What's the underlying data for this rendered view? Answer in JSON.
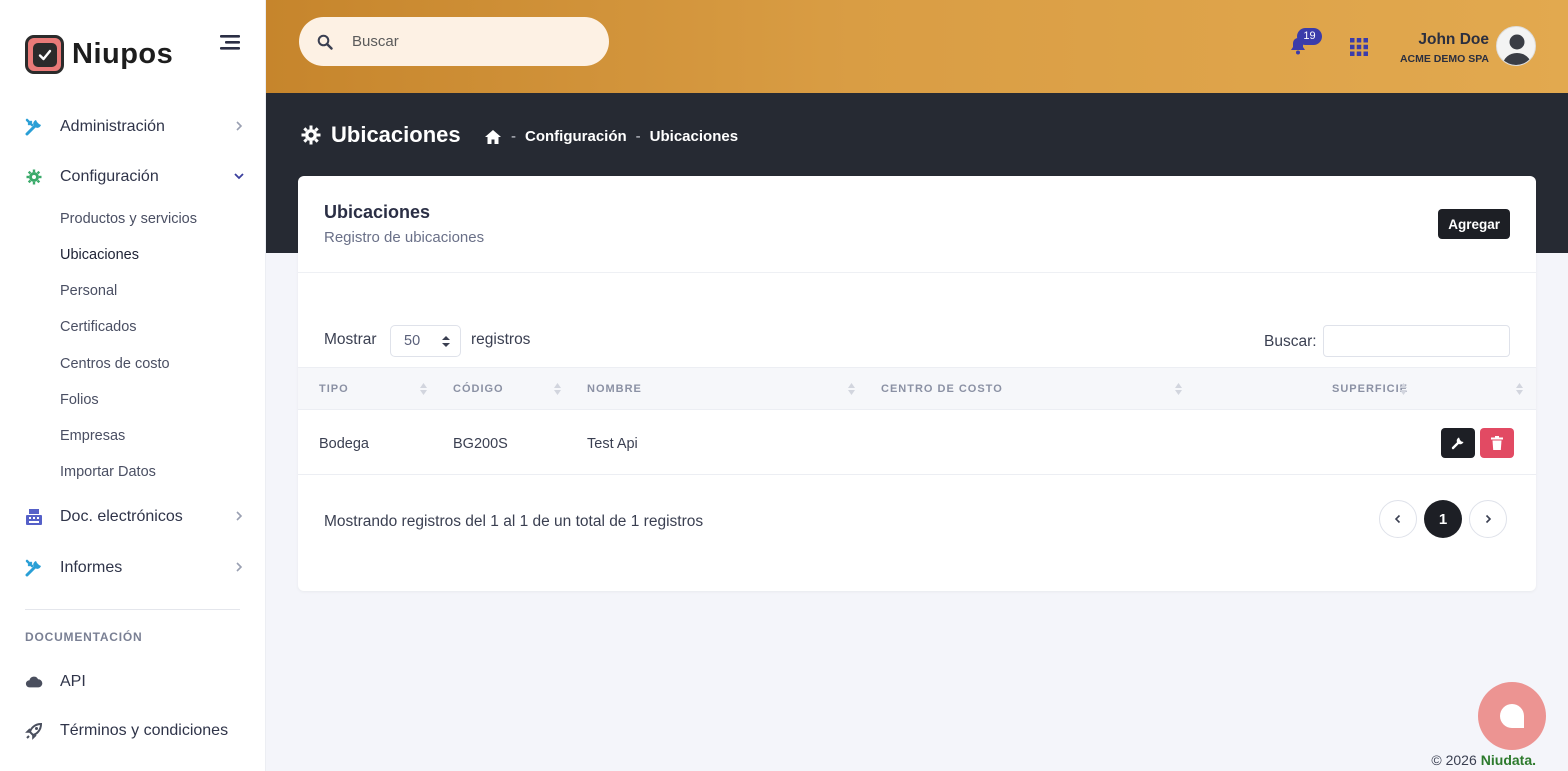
{
  "brand": {
    "name": "Niupos"
  },
  "sidebar": {
    "items": [
      {
        "label": "Administración",
        "icon": "tools-icon"
      },
      {
        "label": "Configuración",
        "icon": "gear-icon"
      },
      {
        "label": "Doc. electrónicos",
        "icon": "cash-register-icon"
      },
      {
        "label": "Informes",
        "icon": "tools-icon"
      }
    ],
    "subitems": [
      "Productos y servicios",
      "Ubicaciones",
      "Personal",
      "Certificados",
      "Centros de costo",
      "Folios",
      "Empresas",
      "Importar Datos"
    ],
    "section_label": "DOCUMENTACIÓN",
    "docs": [
      {
        "label": "API",
        "icon": "cloud-icon"
      },
      {
        "label": "Términos y condiciones",
        "icon": "rocket-icon"
      }
    ]
  },
  "topbar": {
    "search_placeholder": "Buscar",
    "notifications": "19",
    "user_name": "John Doe",
    "user_company": "ACME DEMO SPA"
  },
  "header": {
    "title": "Ubicaciones",
    "breadcrumb": [
      "Configuración",
      "Ubicaciones"
    ],
    "separator": "-"
  },
  "card": {
    "title": "Ubicaciones",
    "subtitle": "Registro de ubicaciones",
    "add_label": "Agregar",
    "show_label": "Mostrar",
    "show_value": "50",
    "show_suffix": "registros",
    "search_label": "Buscar:",
    "columns": [
      "TIPO",
      "CÓDIGO",
      "NOMBRE",
      "CENTRO DE COSTO",
      "SUPERFICIE"
    ],
    "rows": [
      {
        "tipo": "Bodega",
        "codigo": "BG200S",
        "nombre": "Test Api",
        "centro": "",
        "superficie": ""
      }
    ],
    "info": "Mostrando registros del 1 al 1 de un total de 1 registros",
    "current_page": "1"
  },
  "footer": {
    "copyright": "© 2026",
    "brand": "Niudata."
  },
  "colors": {
    "accent": "#d99d44",
    "dark": "#262a33",
    "danger": "#e24a63",
    "chat": "#ec9492"
  }
}
